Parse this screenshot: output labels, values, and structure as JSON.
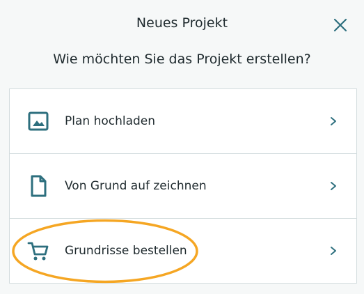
{
  "dialog": {
    "title": "Neues Projekt",
    "close_icon": "close-icon",
    "question": "Wie möchten Sie das Projekt erstellen?"
  },
  "options": [
    {
      "label": "Plan hochladen",
      "icon": "image-icon"
    },
    {
      "label": "Von Grund auf zeichnen",
      "icon": "document-icon"
    },
    {
      "label": "Grundrisse bestellen",
      "icon": "cart-icon"
    }
  ],
  "colors": {
    "accent": "#2d6f7e",
    "highlight": "#f5a623",
    "background": "#f6f8f8",
    "text": "#1f2a2e"
  }
}
